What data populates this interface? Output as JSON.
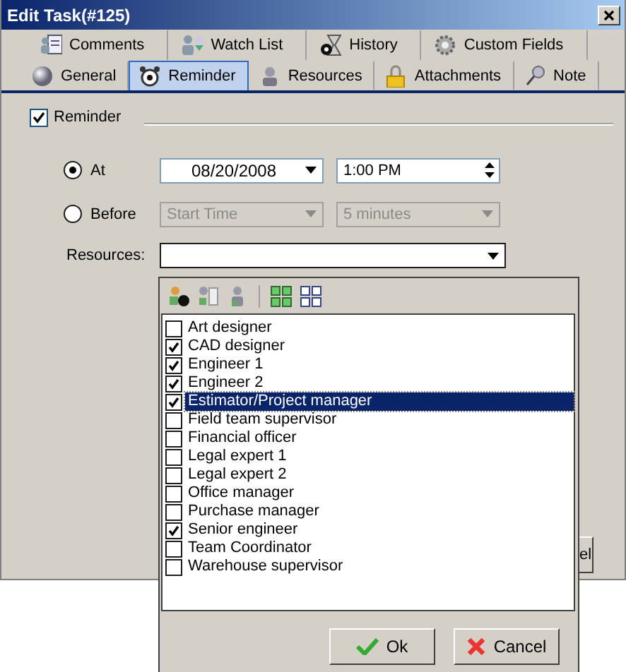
{
  "window": {
    "title": "Edit Task(#125)"
  },
  "tab_rows": [
    {
      "tabs": [
        {
          "label": "Comments",
          "selected": false
        },
        {
          "label": "Watch List",
          "selected": false
        },
        {
          "label": "History",
          "selected": false
        },
        {
          "label": "Custom Fields",
          "selected": false
        }
      ]
    },
    {
      "tabs": [
        {
          "label": "General",
          "selected": false
        },
        {
          "label": "Reminder",
          "selected": true
        },
        {
          "label": "Resources",
          "selected": false
        },
        {
          "label": "Attachments",
          "selected": false
        },
        {
          "label": "Note",
          "selected": false
        }
      ]
    }
  ],
  "reminder": {
    "label": "Reminder",
    "checked": true
  },
  "options": [
    {
      "label": "At",
      "selected": true,
      "fields": [
        {
          "kind": "dropdown",
          "value": "08/20/2008",
          "disabled": false
        },
        {
          "kind": "spinner",
          "value": "1:00 PM",
          "disabled": false
        }
      ]
    },
    {
      "label": "Before",
      "selected": false,
      "fields": [
        {
          "kind": "dropdown",
          "value": "Start Time",
          "disabled": true
        },
        {
          "kind": "dropdown",
          "value": "5 minutes",
          "disabled": true
        }
      ]
    }
  ],
  "resources": {
    "label": "Resources:"
  },
  "popup": {
    "items": [
      {
        "label": "Art designer",
        "checked": false,
        "selected": false
      },
      {
        "label": "CAD designer",
        "checked": true,
        "selected": false
      },
      {
        "label": "Engineer 1",
        "checked": true,
        "selected": false
      },
      {
        "label": "Engineer 2",
        "checked": true,
        "selected": false
      },
      {
        "label": "Estimator/Project manager",
        "checked": true,
        "selected": true
      },
      {
        "label": "Field team supervisor",
        "checked": false,
        "selected": false
      },
      {
        "label": "Financial officer",
        "checked": false,
        "selected": false
      },
      {
        "label": "Legal expert 1",
        "checked": false,
        "selected": false
      },
      {
        "label": "Legal expert 2",
        "checked": false,
        "selected": false
      },
      {
        "label": "Office manager",
        "checked": false,
        "selected": false
      },
      {
        "label": "Purchase manager",
        "checked": false,
        "selected": false
      },
      {
        "label": "Senior engineer",
        "checked": true,
        "selected": false
      },
      {
        "label": "Team Coordinator",
        "checked": false,
        "selected": false
      },
      {
        "label": "Warehouse supervisor",
        "checked": false,
        "selected": false
      }
    ],
    "buttons": [
      {
        "kind": "ok",
        "label": "Ok"
      },
      {
        "kind": "cancel",
        "label": "Cancel"
      }
    ]
  },
  "hidden_button": {
    "label": "el"
  }
}
